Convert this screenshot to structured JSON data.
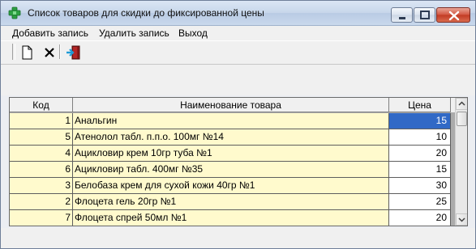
{
  "window": {
    "title": "Список товаров для скидки до фиксированной цены"
  },
  "menu": {
    "add": "Добавить запись",
    "delete": "Удалить запись",
    "exit": "Выход"
  },
  "toolbar": {
    "buttons": [
      {
        "icon": "new-document-icon"
      },
      {
        "icon": "delete-x-icon"
      },
      {
        "icon": "exit-door-icon"
      }
    ]
  },
  "grid": {
    "columns": [
      "Код",
      "Наименование товара",
      "Цена"
    ],
    "rows": [
      {
        "code": "1",
        "name": "Анальгин",
        "price": "15"
      },
      {
        "code": "5",
        "name": "Атенолол табл. п.п.о. 100мг №14",
        "price": "10"
      },
      {
        "code": "4",
        "name": "Ацикловир крем 10гр туба №1",
        "price": "20"
      },
      {
        "code": "6",
        "name": "Ацикловир табл. 400мг №35",
        "price": "15"
      },
      {
        "code": "3",
        "name": "Белобаза крем для сухой кожи 40гр №1",
        "price": "30"
      },
      {
        "code": "2",
        "name": "Флоцета гель 20гр №1",
        "price": "25"
      },
      {
        "code": "7",
        "name": "Флоцета спрей 50мл №1",
        "price": "20"
      }
    ],
    "selected_row": 0
  },
  "colors": {
    "row_background": "#fffacd",
    "selection": "#3169c6",
    "close_button": "#c23a23"
  }
}
